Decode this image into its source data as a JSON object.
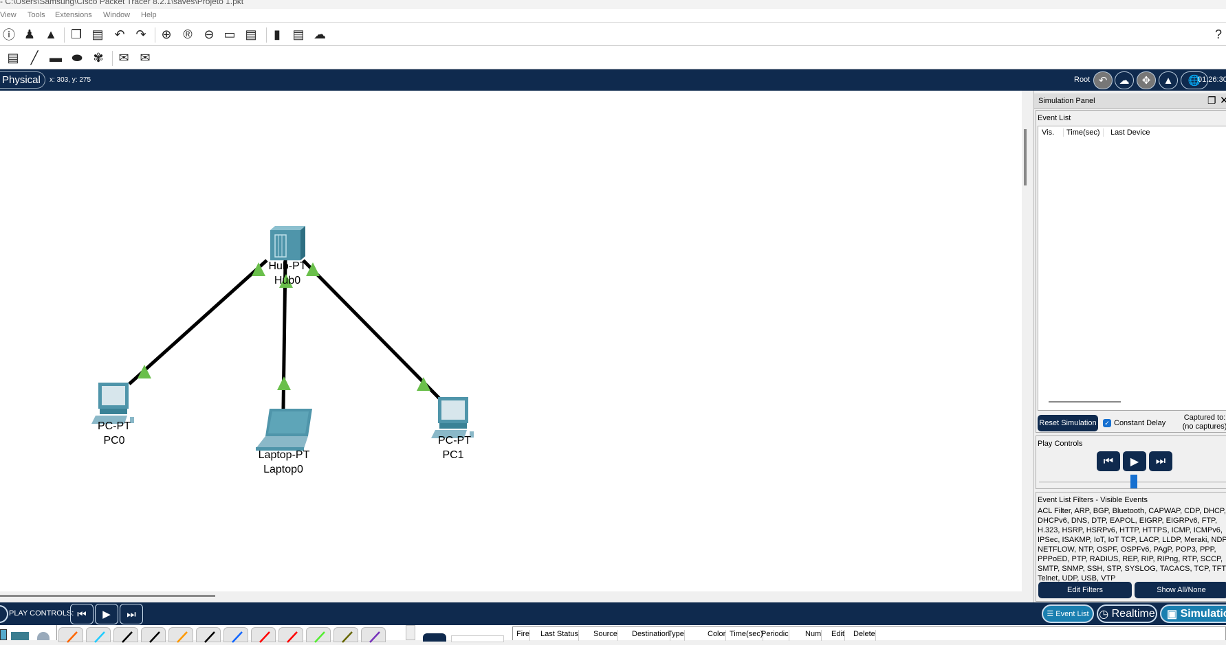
{
  "title": "- C:\\Users\\Samsung\\Cisco Packet Tracer 8.2.1\\saves\\Projeto 1.pkt",
  "menu": [
    "View",
    "Tools",
    "Extensions",
    "Window",
    "Help"
  ],
  "toolbar1": [
    "info-icon",
    "network-info-icon",
    "activity-wizard-icon",
    "copy-icon",
    "paste-icon",
    "undo-icon",
    "redo-icon",
    "zoom-in-icon",
    "zoom-reset-icon",
    "zoom-out-icon",
    "palette-icon",
    "custom-device-icon",
    "device-template-icon",
    "viewport-icon",
    "cloud-window-icon"
  ],
  "toolbar1_help": "?",
  "toolbar2": [
    "note-icon",
    "line-icon",
    "rectangle-icon",
    "ellipse-icon",
    "freeform-icon",
    "simple-pdu-icon",
    "complex-pdu-icon"
  ],
  "nav": {
    "mode": "Physical",
    "mode_visible": "ysical",
    "coords": "x: 303, y: 275",
    "root": "Root",
    "time": "01:26:30"
  },
  "devices": [
    {
      "model": "Hub-PT",
      "name": "Hub0",
      "type": "hub"
    },
    {
      "model": "PC-PT",
      "name": "PC0",
      "type": "pc"
    },
    {
      "model": "Laptop-PT",
      "name": "Laptop0",
      "type": "laptop"
    },
    {
      "model": "PC-PT",
      "name": "PC1",
      "type": "pc"
    }
  ],
  "link_status_color": "#6abf4b",
  "panel": {
    "title": "Simulation Panel",
    "event_list_label": "Event List",
    "columns": [
      "Vis.",
      "Time(sec)",
      "Last Device"
    ],
    "reset_button": "Reset Simulation",
    "constant_delay": "Constant Delay",
    "constant_delay_checked": true,
    "captured_to": "Captured to:",
    "no_captures": "(no captures)",
    "play_controls": "Play Controls",
    "filters_title": "Event List Filters - Visible Events",
    "filters_text": "ACL Filter, ARP, BGP, Bluetooth, CAPWAP, CDP, DHCP, DHCPv6, DNS, DTP, EAPOL, EIGRP, EIGRPv6, FTP, H.323, HSRP, HSRPv6, HTTP, HTTPS, ICMP, ICMPv6, IPSec, ISAKMP, IoT, IoT TCP, LACP, LLDP, Meraki, NDP, NETFLOW, NTP, OSPF, OSPFv6, PAgP, POP3, PPP, PPPoED, PTP, RADIUS, REP, RIP, RIPng, RTP, SCCP, SMTP, SNMP, SSH, STP, SYSLOG, TACACS, TCP, TFTP, Telnet, UDP, USB, VTP",
    "edit_filters": "Edit Filters",
    "show_all": "Show All/None"
  },
  "bottom": {
    "play_controls": "PLAY CONTROLS:",
    "event_list": "Event List",
    "realtime": "Realtime",
    "simulation": "Simulation"
  },
  "cable_colors": [
    "#f60",
    "#2cf",
    "#000",
    "#000",
    "#f90",
    "#000",
    "#16f",
    "#f00",
    "#f00",
    "#5e3",
    "#660",
    "#73b"
  ],
  "pdu_columns": [
    "Fire",
    "Last Status",
    "Source",
    "Destination",
    "Type",
    "Color",
    "Time(sec)",
    "Periodic",
    "Num",
    "Edit",
    "Delete"
  ],
  "accent": "#0f2a4e"
}
